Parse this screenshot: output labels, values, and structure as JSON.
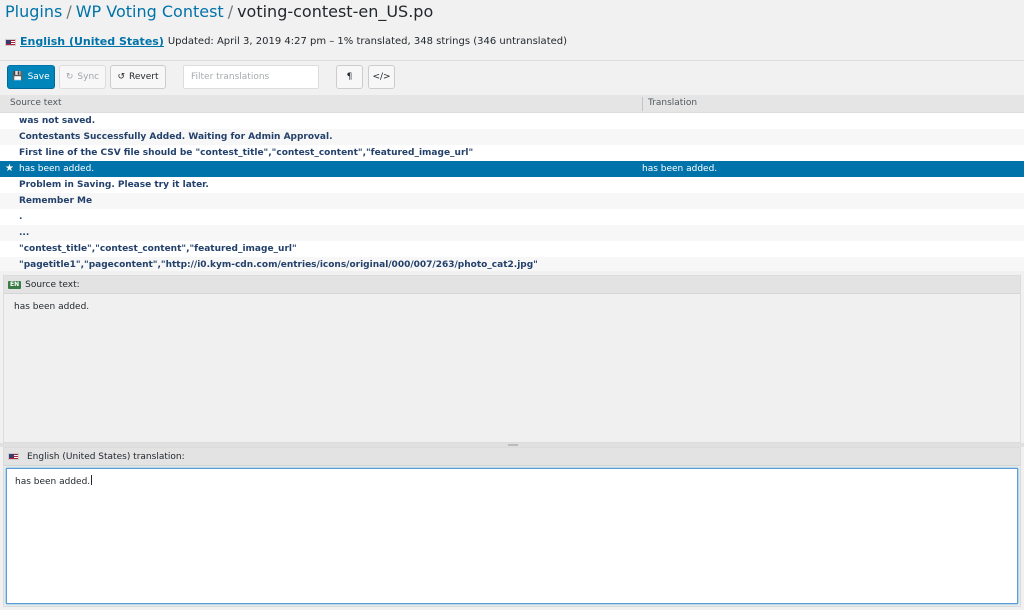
{
  "breadcrumb": {
    "plugins": "Plugins",
    "sep1": "/",
    "plugin": "WP Voting Contest",
    "sep2": "/",
    "file": "voting-contest-en_US.po"
  },
  "status": {
    "language": "English (United States)",
    "details": "Updated: April 3, 2019 4:27 pm – 1% translated, 348 strings (346 untranslated)"
  },
  "toolbar": {
    "save_label": "Save",
    "sync_label": "Sync",
    "revert_label": "Revert",
    "filter_placeholder": "Filter translations",
    "pilcrow_label": "¶",
    "code_label": "</>"
  },
  "grid": {
    "col_source": "Source text",
    "col_translation": "Translation",
    "rows": [
      {
        "source": "was not saved.",
        "translation": ""
      },
      {
        "source": "Contestants Successfully Added. Waiting for Admin Approval.",
        "translation": ""
      },
      {
        "source": "First line of the CSV file should be \"contest_title\",\"contest_content\",\"featured_image_url\"",
        "translation": ""
      },
      {
        "source": "has been added.",
        "translation": "has been added."
      },
      {
        "source": "Problem in Saving. Please try it later.",
        "translation": ""
      },
      {
        "source": "Remember Me",
        "translation": ""
      },
      {
        "source": ".",
        "translation": ""
      },
      {
        "source": "...",
        "translation": ""
      },
      {
        "source": "\"contest_title\",\"contest_content\",\"featured_image_url\"",
        "translation": ""
      },
      {
        "source": "\"pagetitle1\",\"pagecontent\",\"http://i0.kym-cdn.com/entries/icons/original/000/007/263/photo_cat2.jpg\"",
        "translation": ""
      }
    ]
  },
  "source_panel": {
    "badge": "EN",
    "heading": "Source text:",
    "text": "has been added."
  },
  "translation_panel": {
    "heading": "English (United States) translation:",
    "value": "has been added."
  },
  "colors": {
    "accent": "#0073aa",
    "primary_button": "#0085ba",
    "row_text": "#23416b"
  }
}
